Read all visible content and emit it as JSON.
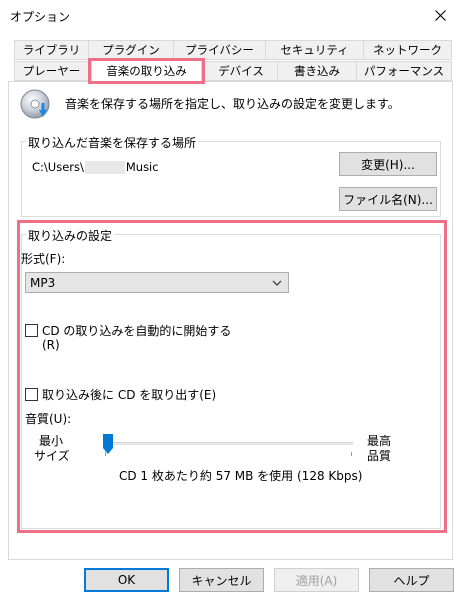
{
  "window": {
    "title": "オプション"
  },
  "tabs": {
    "row1": [
      "ライブラリ",
      "プラグイン",
      "プライバシー",
      "セキュリティ",
      "ネットワーク"
    ],
    "row2": [
      "プレーヤー",
      "音楽の取り込み",
      "デバイス",
      "書き込み",
      "パフォーマンス"
    ],
    "active": "音楽の取り込み"
  },
  "header": {
    "description": "音楽を保存する場所を指定し、取り込みの設定を変更します。"
  },
  "save_location": {
    "legend": "取り込んだ音楽を保存する場所",
    "path_prefix": "C:\\Users\\",
    "path_suffix": "Music",
    "change_button": "変更(H)...",
    "filename_button": "ファイル名(N)..."
  },
  "rip_settings": {
    "legend": "取り込みの設定",
    "format_label": "形式(F):",
    "format_value": "MP3",
    "auto_rip_label_line1": "CD の取り込みを自動的に開始する",
    "auto_rip_label_line2": "(R)",
    "auto_rip_checked": false,
    "eject_label": "取り込み後に CD を取り出す(E)",
    "eject_checked": false,
    "quality_label": "音質(U):",
    "quality_min_line1": "最小",
    "quality_min_line2": "サイズ",
    "quality_max_line1": "最高",
    "quality_max_line2": "品質",
    "quality_level": 0,
    "quality_info": "CD 1 枚あたり約 57 MB を使用 (128 Kbps)"
  },
  "footer": {
    "ok": "OK",
    "cancel": "キャンセル",
    "apply": "適用(A)",
    "help": "ヘルプ"
  },
  "colors": {
    "highlight": "#ef6f86",
    "focus": "#0078d7",
    "slider_thumb": "#0078d7"
  }
}
